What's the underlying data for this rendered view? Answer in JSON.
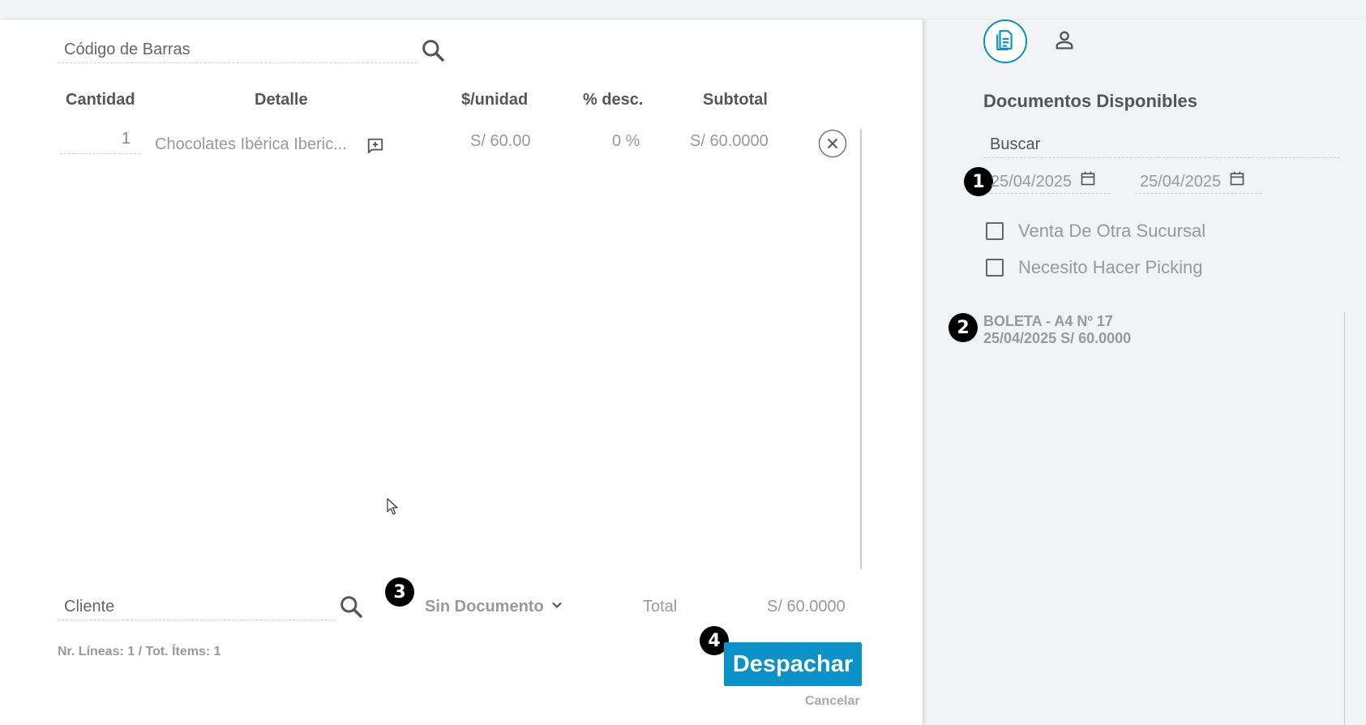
{
  "barcode": {
    "placeholder": "Código de Barras"
  },
  "table": {
    "headers": [
      "Cantidad",
      "Detalle",
      "$/unidad",
      "% desc.",
      "Subtotal"
    ],
    "rows": [
      {
        "quantity": "1",
        "detail": "Chocolates Ibérica Iberic...",
        "unit_price": "S/ 60.00",
        "discount": "0 %",
        "subtotal": "S/ 60.0000"
      }
    ]
  },
  "footer": {
    "client_placeholder": "Cliente",
    "document_select": "Sin Documento",
    "total_label": "Total",
    "total_value": "S/ 60.0000",
    "lines_summary": "Nr. Líneas: 1 / Tot. Ítems: 1",
    "dispatch_label": "Despachar",
    "cancel_label": "Cancelar"
  },
  "right_panel": {
    "title": "Documentos Disponibles",
    "search_placeholder": "Buscar",
    "date_from": "25/04/2025",
    "date_to": "25/04/2025",
    "checkboxes": [
      "Venta De Otra Sucursal",
      "Necesito Hacer Picking"
    ],
    "documents": [
      {
        "title": "BOLETA - A4 Nº 17",
        "detail": "25/04/2025 S/ 60.0000"
      }
    ]
  },
  "markers": [
    "1",
    "2",
    "3",
    "4"
  ],
  "colors": {
    "accent": "#0a91c8",
    "marker": "#000000"
  },
  "icons": [
    "search-icon",
    "add-comment-icon",
    "close-circle-icon",
    "chevron-down-icon",
    "document-icon",
    "person-icon",
    "calendar-icon",
    "checkbox-icon",
    "cursor-icon"
  ]
}
